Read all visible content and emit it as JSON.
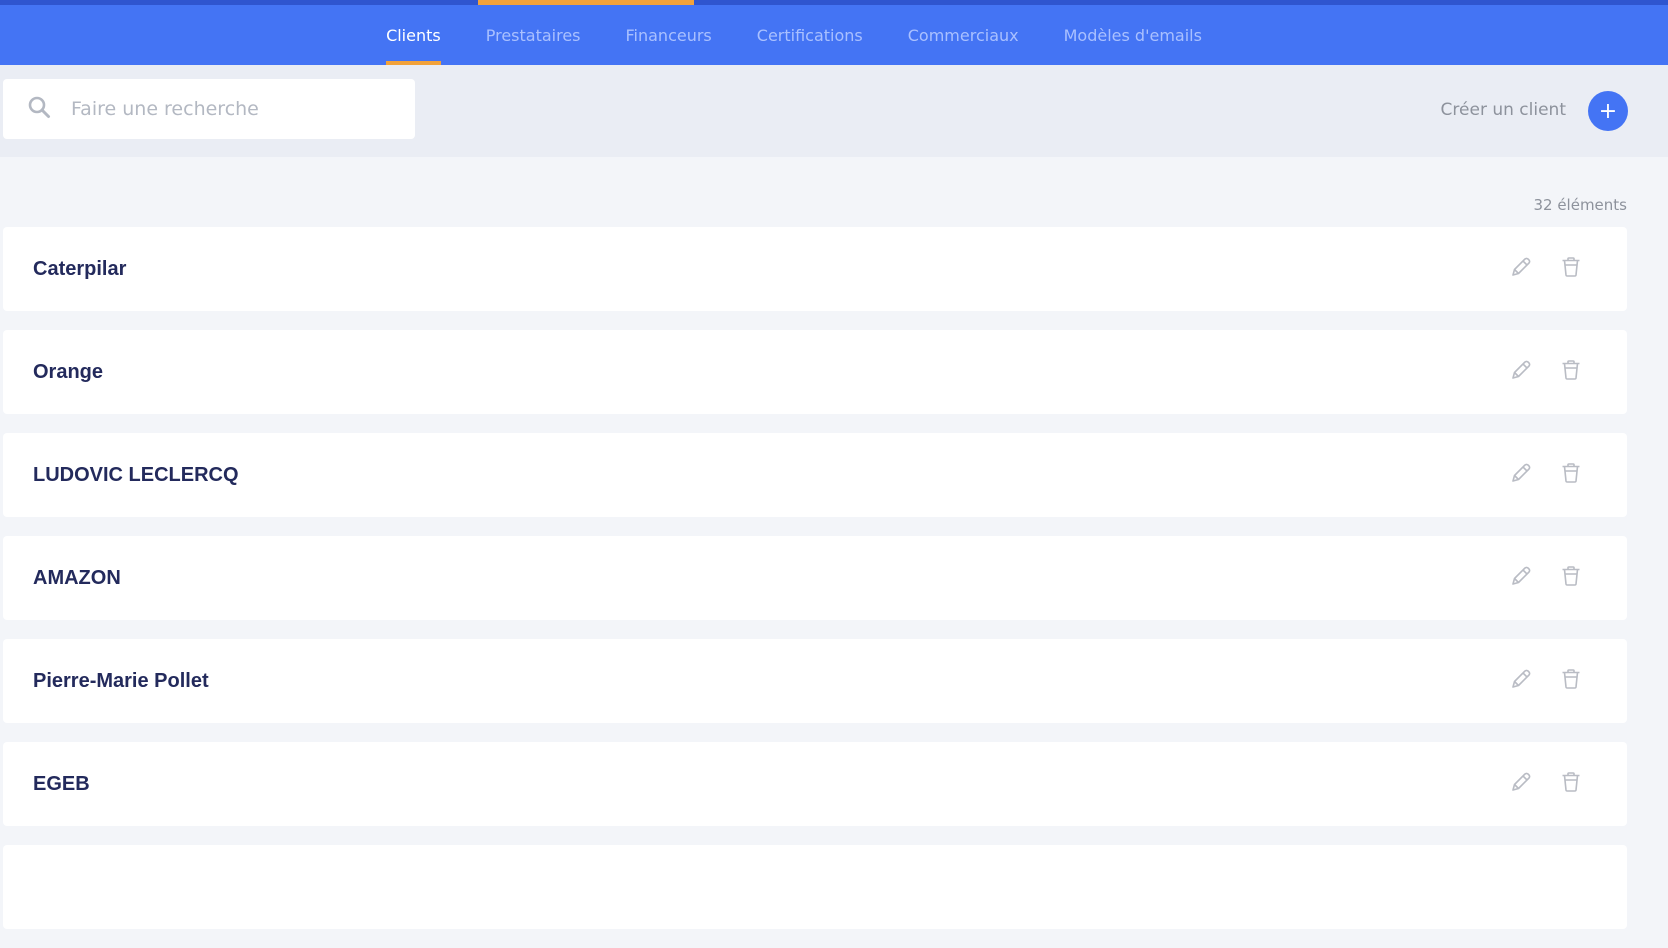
{
  "nav": {
    "tabs": [
      {
        "label": "Clients",
        "active": true
      },
      {
        "label": "Prestataires",
        "active": false
      },
      {
        "label": "Financeurs",
        "active": false
      },
      {
        "label": "Certifications",
        "active": false
      },
      {
        "label": "Commerciaux",
        "active": false
      },
      {
        "label": "Modèles d'emails",
        "active": false
      }
    ]
  },
  "search": {
    "placeholder": "Faire une recherche",
    "icon": "search-icon"
  },
  "create": {
    "label": "Créer un client",
    "button_symbol": "+"
  },
  "list": {
    "count_label": "32 éléments",
    "items": [
      {
        "name": "Caterpilar"
      },
      {
        "name": "Orange"
      },
      {
        "name": "LUDOVIC LECLERCQ"
      },
      {
        "name": "AMAZON"
      },
      {
        "name": "Pierre-Marie Pollet"
      },
      {
        "name": "EGEB"
      },
      {
        "name": ""
      }
    ]
  },
  "colors": {
    "primary": "#4474f4",
    "accent": "#f2a23a",
    "text_dark": "#232a5c",
    "muted": "#8d929c"
  }
}
